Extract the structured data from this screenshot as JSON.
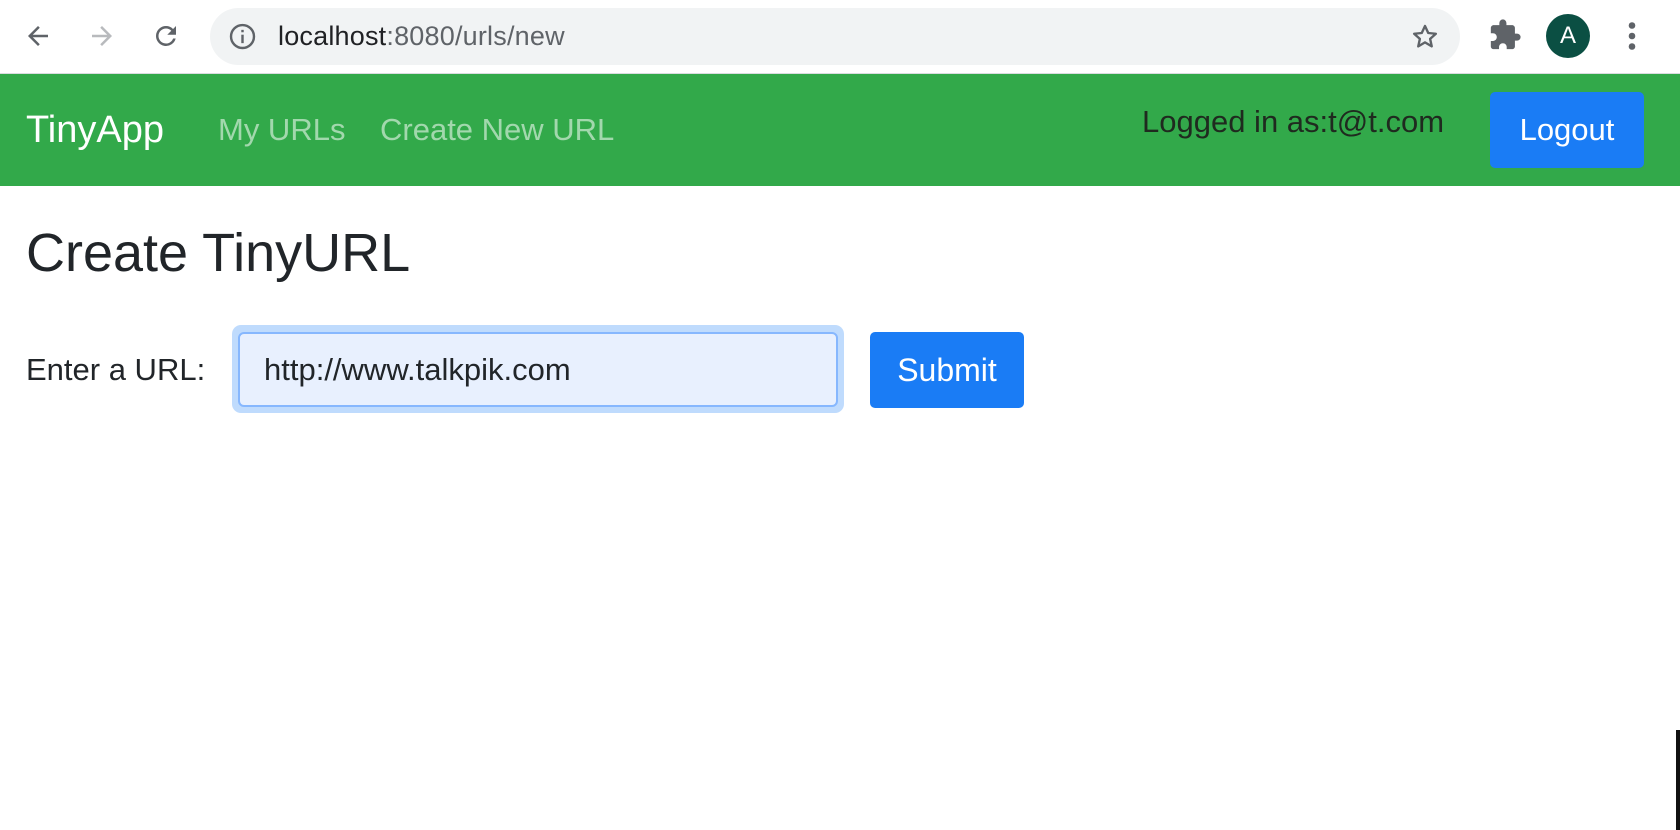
{
  "browser": {
    "url_host": "localhost",
    "url_path": ":8080/urls/new",
    "profile_initial": "A",
    "icons": {
      "back": "arrow-left-icon",
      "forward": "arrow-right-icon",
      "reload": "reload-icon",
      "site_info": "info-icon",
      "bookmark": "star-icon",
      "extensions": "puzzle-piece-icon",
      "menu": "three-dots-vertical-icon"
    }
  },
  "navbar": {
    "brand": "TinyApp",
    "links": [
      {
        "label": "My URLs"
      },
      {
        "label": "Create New URL"
      }
    ],
    "logged_in_text": "Logged in as:t@t.com",
    "logout_label": "Logout",
    "background_color": "#32a94a"
  },
  "main": {
    "title": "Create TinyURL",
    "form": {
      "label": "Enter a URL:",
      "input_value": "http://www.talkpik.com",
      "submit_label": "Submit"
    }
  },
  "colors": {
    "primary_button": "#1a7cf5",
    "input_focus_bg": "#e8f0fe",
    "text": "#212529"
  }
}
